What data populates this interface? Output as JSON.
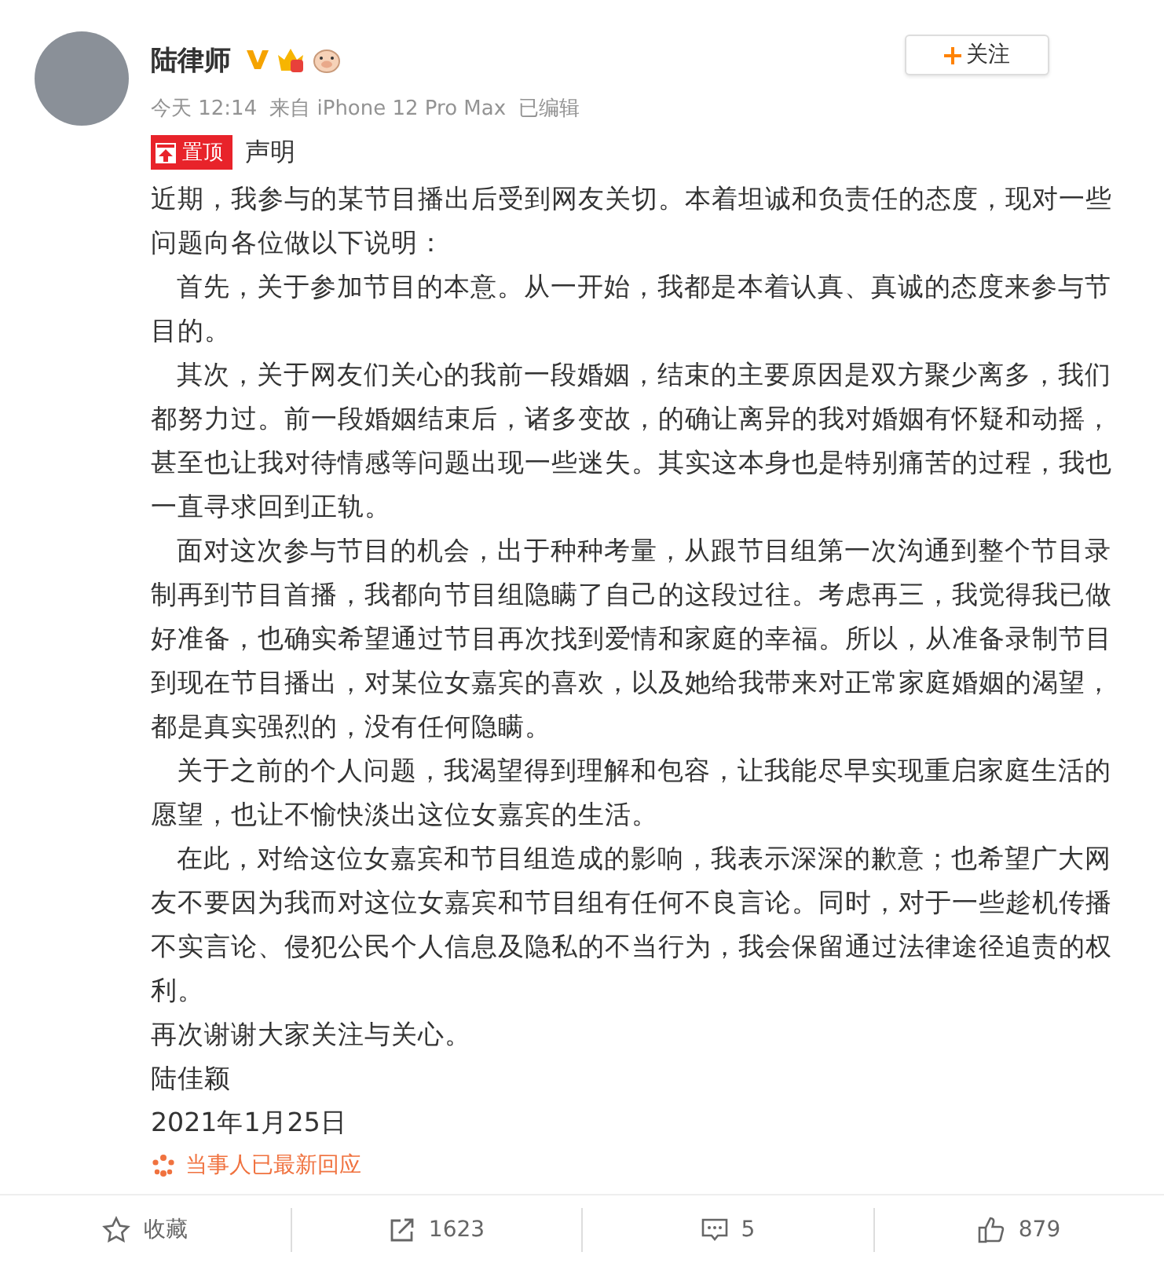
{
  "post": {
    "author": "陆律师",
    "meta": {
      "time": "今天 12:14",
      "source": "来自 iPhone 12 Pro Max",
      "edited": "已编辑"
    },
    "follow_button": "关注",
    "pinned_tag": "置顶",
    "title": "声明",
    "paragraphs": [
      {
        "text": "近期，我参与的某节目播出后受到网友关切。本着坦诚和负责任的态度，现对一些问题向各位做以下说明：",
        "indented": false
      },
      {
        "text": "首先，关于参加节目的本意。从一开始，我都是本着认真、真诚的态度来参与节目的。",
        "indented": true
      },
      {
        "text": "其次，关于网友们关心的我前一段婚姻，结束的主要原因是双方聚少离多，我们都努力过。前一段婚姻结束后，诸多变故，的确让离异的我对婚姻有怀疑和动摇，甚至也让我对待情感等问题出现一些迷失。其实这本身也是特别痛苦的过程，我也一直寻求回到正轨。",
        "indented": true
      },
      {
        "text": "面对这次参与节目的机会，出于种种考量，从跟节目组第一次沟通到整个节目录制再到节目首播，我都向节目组隐瞒了自己的这段过往。考虑再三，我觉得我已做好准备，也确实希望通过节目再次找到爱情和家庭的幸福。所以，从准备录制节目到现在节目播出，对某位女嘉宾的喜欢，以及她给我带来对正常家庭婚姻的渴望，都是真实强烈的，没有任何隐瞒。",
        "indented": true
      },
      {
        "text": "关于之前的个人问题，我渴望得到理解和包容，让我能尽早实现重启家庭生活的愿望，也让不愉快淡出这位女嘉宾的生活。",
        "indented": true
      },
      {
        "text": "在此，对给这位女嘉宾和节目组造成的影响，我表示深深的歉意；也希望广大网友不要因为我而对这位女嘉宾和节目组有任何不良言论。同时，对于一些趁机传播不实言论、侵犯公民个人信息及隐私的不当行为，我会保留通过法律途径追责的权利。",
        "indented": true
      },
      {
        "text": "再次谢谢大家关注与关心。",
        "indented": false
      },
      {
        "text": "陆佳颖",
        "indented": false
      },
      {
        "text": "2021年1月25日",
        "indented": false
      }
    ],
    "response_note": "当事人已最新回应"
  },
  "actions": [
    {
      "kind": "favorite",
      "label": "收藏"
    },
    {
      "kind": "repost",
      "label": "1623"
    },
    {
      "kind": "comment",
      "label": "5"
    },
    {
      "kind": "like",
      "label": "879"
    }
  ]
}
